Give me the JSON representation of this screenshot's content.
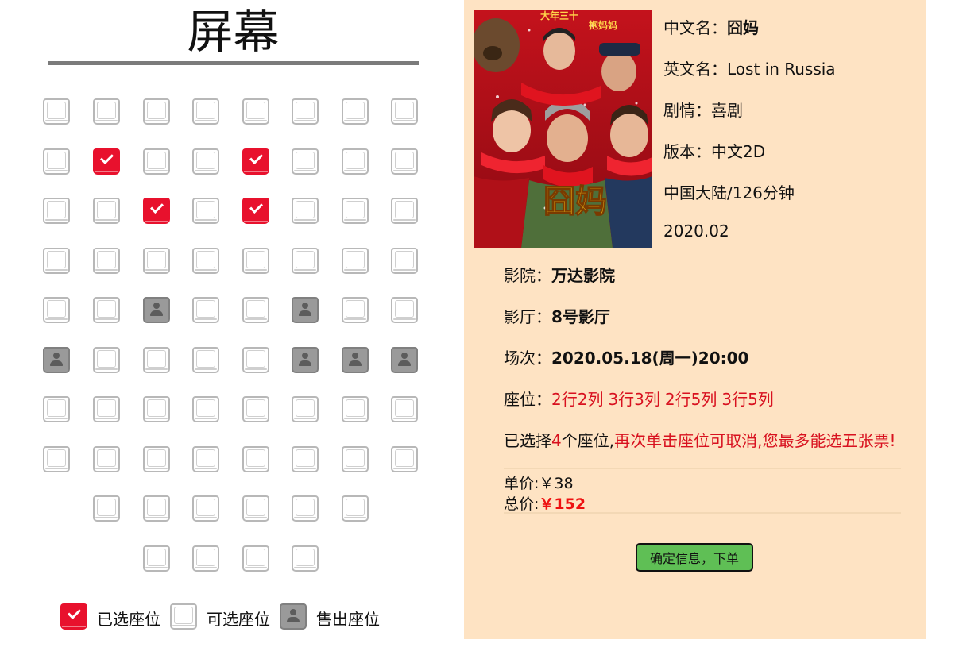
{
  "screen": {
    "title": "屏幕"
  },
  "seat_map": {
    "rows": [
      {
        "offset": 0,
        "seats": [
          "available",
          "available",
          "available",
          "available",
          "available",
          "available",
          "available",
          "available"
        ]
      },
      {
        "offset": 0,
        "seats": [
          "available",
          "selected",
          "available",
          "available",
          "selected",
          "available",
          "available",
          "available"
        ]
      },
      {
        "offset": 0,
        "seats": [
          "available",
          "available",
          "selected",
          "available",
          "selected",
          "available",
          "available",
          "available"
        ]
      },
      {
        "offset": 0,
        "seats": [
          "available",
          "available",
          "available",
          "available",
          "available",
          "available",
          "available",
          "available"
        ]
      },
      {
        "offset": 0,
        "seats": [
          "available",
          "available",
          "sold",
          "available",
          "available",
          "sold",
          "available",
          "available"
        ]
      },
      {
        "offset": 0,
        "seats": [
          "sold",
          "available",
          "available",
          "available",
          "available",
          "sold",
          "sold",
          "sold"
        ]
      },
      {
        "offset": 0,
        "seats": [
          "available",
          "available",
          "available",
          "available",
          "available",
          "available",
          "available",
          "available"
        ]
      },
      {
        "offset": 0,
        "seats": [
          "available",
          "available",
          "available",
          "available",
          "available",
          "available",
          "available",
          "available"
        ]
      },
      {
        "offset": 1,
        "seats": [
          "available",
          "available",
          "available",
          "available",
          "available",
          "available"
        ]
      },
      {
        "offset": 2,
        "seats": [
          "available",
          "available",
          "available",
          "available"
        ]
      }
    ]
  },
  "legend": {
    "selected_label": "已选座位",
    "available_label": "可选座位",
    "sold_label": "售出座位"
  },
  "movie": {
    "poster_icon": "movie-poster-image",
    "poster_text": "囧妈",
    "poster_text_small": "大年三十",
    "poster_text_corner": "抱妈妈",
    "chinese_name_label": "中文名：",
    "chinese_name": "囧妈",
    "english_name_label": "英文名：",
    "english_name": "Lost in Russia",
    "genre_label": "剧情：",
    "genre": "喜剧",
    "version_label": "版本：",
    "version": "中文2D",
    "region_duration": "中国大陆/126分钟",
    "release": "2020.02"
  },
  "cinema": {
    "cinema_label": "影院：",
    "cinema_name": "万达影院",
    "hall_label": "影厅：",
    "hall_name": "8号影厅",
    "session_label": "场次：",
    "session_time": "2020.05.18(周一)20:00",
    "seats_label": "座位：",
    "selected_seats": [
      "2行2列",
      "3行3列",
      "2行5列",
      "3行5列"
    ],
    "selection_prefix": "已选择",
    "selection_count": "4",
    "selection_suffix": "个座位,",
    "selection_hint": "再次单击座位可取消,您最多能选五张票!",
    "unit_price_label": "单价:",
    "unit_price": "￥38",
    "total_price_label": "总价:",
    "total_price": "￥152",
    "confirm_button": "确定信息，下单"
  },
  "colors": {
    "selected_seat": "#e8112d",
    "sold_seat": "#9a9a9a",
    "panel_bg": "#fee3c3",
    "confirm_bg": "#5fbf55",
    "highlight_red": "#d8111f"
  }
}
